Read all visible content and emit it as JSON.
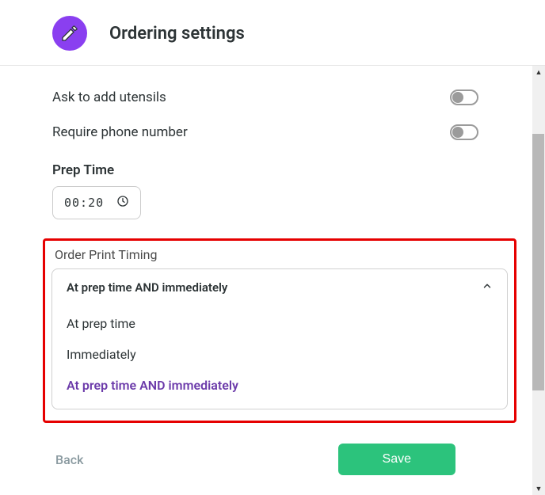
{
  "header": {
    "title": "Ordering settings"
  },
  "settings": {
    "utensils": {
      "label": "Ask to add utensils",
      "enabled": false
    },
    "phone": {
      "label": "Require phone number",
      "enabled": false
    },
    "prepTime": {
      "label": "Prep Time",
      "value": "00:20"
    },
    "orderPrint": {
      "label": "Order Print Timing",
      "selected": "At prep time AND immediately",
      "options": [
        "At prep time",
        "Immediately",
        "At prep time AND immediately"
      ]
    }
  },
  "footer": {
    "back": "Back",
    "save": "Save"
  }
}
